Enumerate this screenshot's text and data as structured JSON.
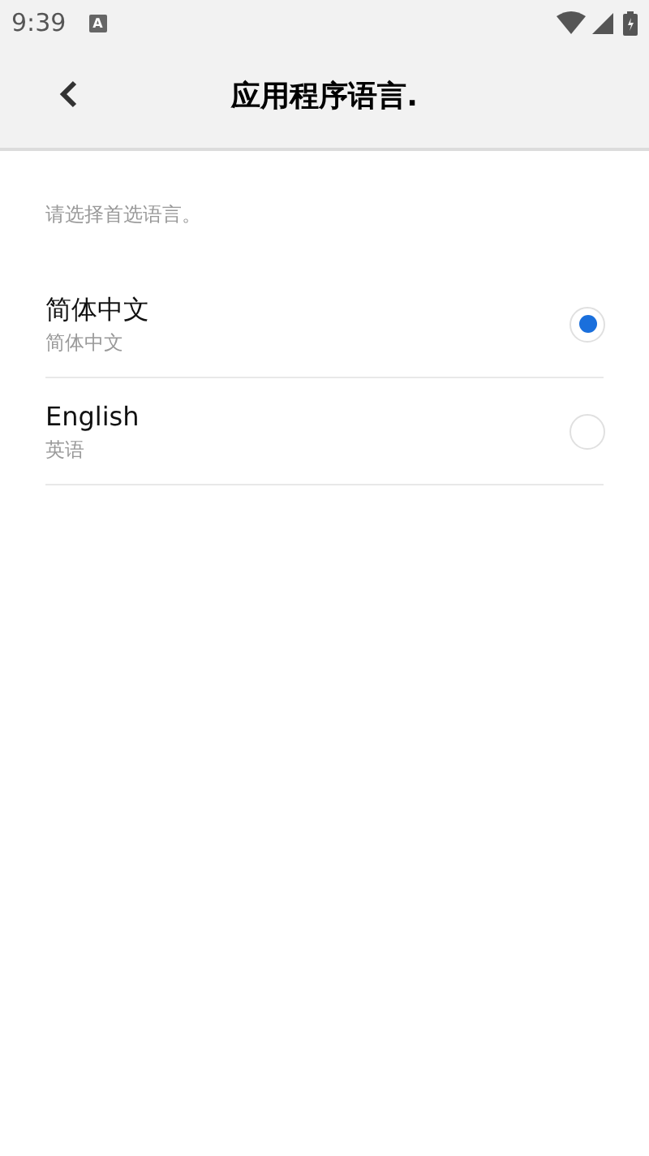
{
  "status_bar": {
    "time": "9:39",
    "notification": "A"
  },
  "header": {
    "title": "应用程序语言."
  },
  "prompt": "请选择首选语言。",
  "languages": [
    {
      "name": "简体中文",
      "subtitle": "简体中文",
      "selected": true
    },
    {
      "name": "English",
      "subtitle": "英语",
      "selected": false
    }
  ]
}
